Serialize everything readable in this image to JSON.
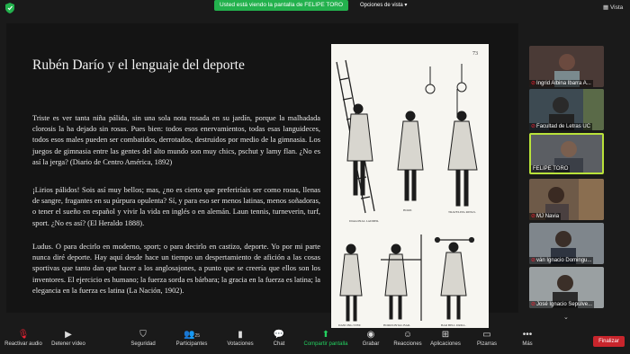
{
  "topbar": {
    "share_banner": "Usted está viendo la pantalla de FELIPE TORO",
    "view_options": "Opciones de vista ▾",
    "view_button": "Vista"
  },
  "slide": {
    "title": "Rubén Darío y el lenguaje del deporte",
    "paragraph1": "Triste es ver tanta niña pálida, sin una sola nota rosada en su jardín, porque la malhadada clorosis la ha dejado sin rosas. Pues bien: todos esos enervamientos, todas esas languideces, todos esos males pueden ser combatidos, derrotados, destruidos por medio de la gimnasia. Los juegos de gimnasia entre las gentes del alto mundo son muy chics, pschut y lamy flan. ¿No es así la jerga? (Diario de Centro América, 1892)",
    "paragraph2": "¡Lirios pálidos! Sois así muy bellos; mas, ¿no es cierto que preferiríais ser como rosas, llenas de sangre, fragantes en su púrpura opulenta? Sí, y para eso ser menos latinas, menos soñadoras, o tener el sueño en español y vivir la vida en inglés o en alemán. Laun tennis, turneverin, turf, sport. ¿No es así? (El Heraldo 1888).",
    "paragraph3": "Ludus. O para decirlo en moderno, sport; o para decirlo en castizo, deporte. Yo por mi parte nunca diré deporte. Hay aquí desde hace un tiempo un despertamiento de afición a las cosas sportivas que tanto dan que hacer a los anglosajones, a punto que se creería que ellos son los inventores. El ejercicio es humano; la fuerza sorda es bárbara; la gracia en la fuerza es latina; la elegancia en la fuerza es latina (La Nación, 1902).",
    "image_page_number": "73",
    "image_captions": [
      "DIAGONAL LADDER.",
      "HOOP.",
      "TRAVELING RINGS.",
      "DANCING STEP.",
      "HORIZONTAL BAR.",
      "BAR BELL DRILL."
    ]
  },
  "participants": [
    {
      "name": "Ingrid Albina Ibarra A...",
      "muted": true
    },
    {
      "name": "Facultad de Letras UC",
      "muted": true
    },
    {
      "name": "FELIPE TORO",
      "muted": false,
      "active": true
    },
    {
      "name": "MJ Navia",
      "muted": true
    },
    {
      "name": "ván Ignacio Domingu...",
      "muted": true
    },
    {
      "name": "José Ignacio Sepúlve...",
      "muted": true
    }
  ],
  "toolbar": {
    "mute": "Reactivar audio",
    "video": "Detener vídeo",
    "security": "Seguridad",
    "participants": "Participantes",
    "participants_count": "25",
    "polls": "Votaciones",
    "chat": "Chat",
    "share": "Compartir pantalla",
    "record": "Grabar",
    "reactions": "Reacciones",
    "apps": "Aplicaciones",
    "whiteboards": "Pizarras",
    "more": "Más",
    "end": "Finalizar"
  },
  "colors": {
    "accent_green": "#23b14d",
    "active_border": "#b9e23a",
    "end_red": "#c8252c"
  }
}
